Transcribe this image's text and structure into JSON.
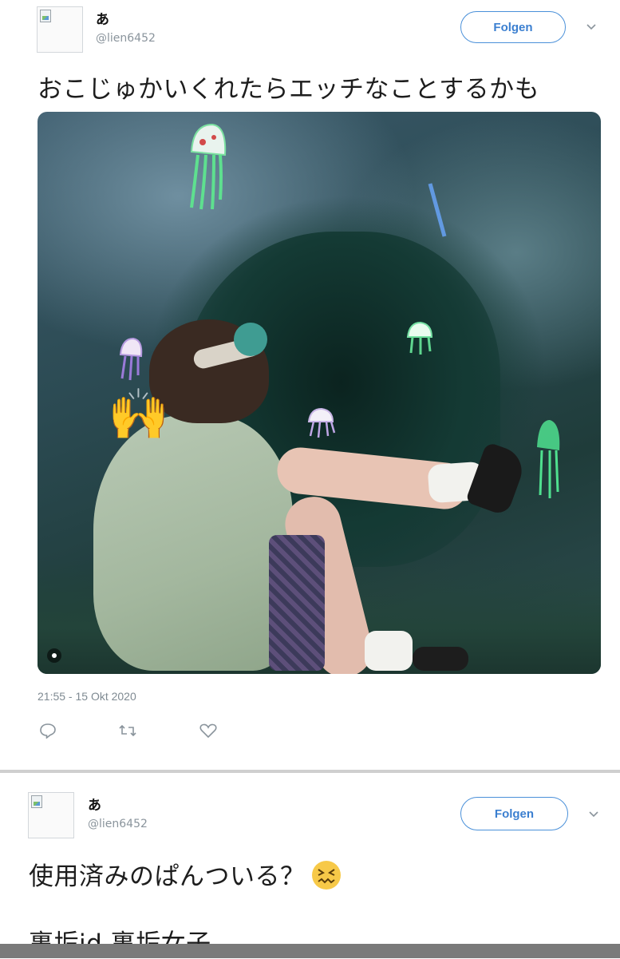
{
  "tweet1": {
    "display_name": "あ",
    "handle": "@lien6452",
    "follow_label": "Folgen",
    "text": "おこじゅかいくれたらエッチなことするかも",
    "timestamp": "21:55 - 15 Okt 2020",
    "actions": [
      "reply-icon",
      "retweet-icon",
      "like-icon"
    ]
  },
  "tweet2": {
    "display_name": "あ",
    "handle": "@lien6452",
    "follow_label": "Folgen",
    "text": "使用済みのぱんついる？",
    "hashtags": "裏垢jd 裏垢女子"
  },
  "colors": {
    "accent": "#4a90d9",
    "text": "#1d1d1d",
    "muted": "#8a949c"
  }
}
